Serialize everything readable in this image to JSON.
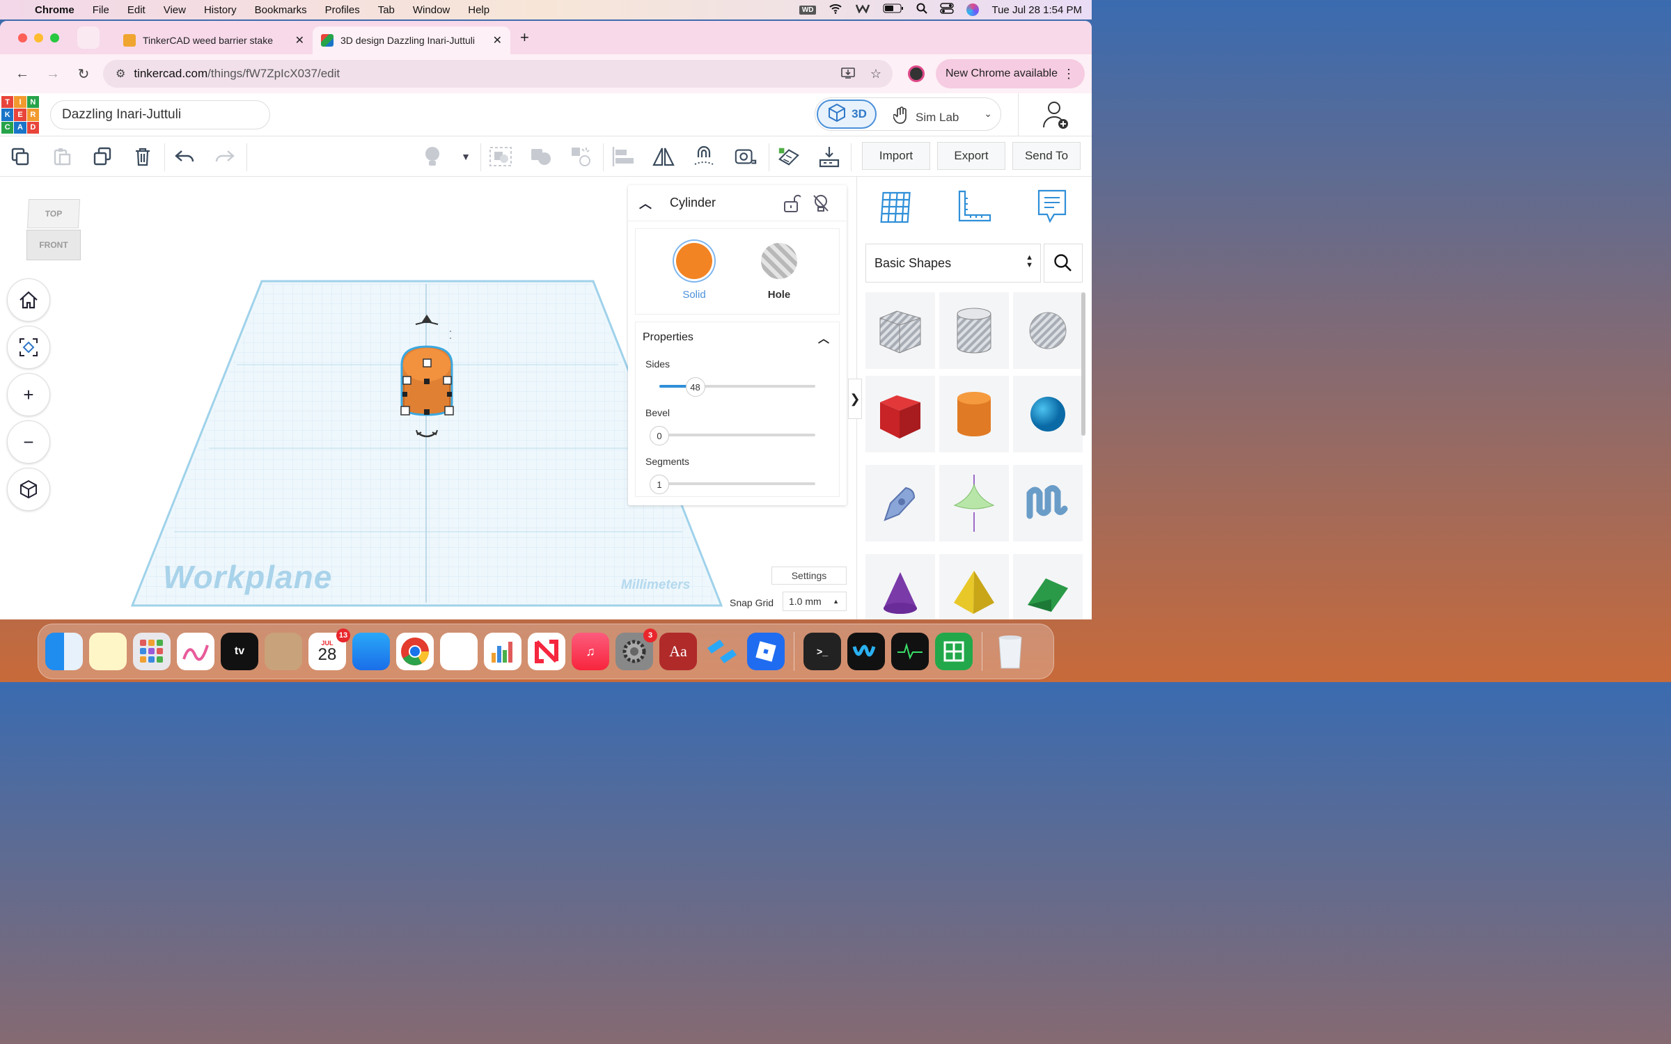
{
  "menubar": {
    "app": "Chrome",
    "items": [
      "File",
      "Edit",
      "View",
      "History",
      "Bookmarks",
      "Profiles",
      "Tab",
      "Window",
      "Help"
    ],
    "wd": "WD",
    "datetime": "Tue Jul 28  1:54 PM"
  },
  "browser": {
    "tabs": [
      {
        "title": "TinkerCAD weed barrier stake"
      },
      {
        "title": "3D design Dazzling Inari-Juttuli"
      }
    ],
    "url_domain": "tinkercad.com",
    "url_path": "/things/fW7ZpIcX037/edit",
    "new_chrome": "New Chrome available"
  },
  "logo": [
    "T",
    "I",
    "N",
    "K",
    "E",
    "R",
    "C",
    "A",
    "D"
  ],
  "header": {
    "design_name": "Dazzling Inari-Juttuli",
    "mode_3d": "3D",
    "mode_sim": "Sim Lab"
  },
  "toolbar": {
    "import": "Import",
    "export": "Export",
    "send_to": "Send To"
  },
  "viewcube": {
    "top": "TOP",
    "front": "FRONT"
  },
  "inspector": {
    "shape_name": "Cylinder",
    "solid_label": "Solid",
    "hole_label": "Hole",
    "properties_label": "Properties",
    "props": [
      {
        "label": "Sides",
        "value": "48",
        "fraction": 0.23
      },
      {
        "label": "Bevel",
        "value": "0",
        "fraction": 0
      },
      {
        "label": "Segments",
        "value": "1",
        "fraction": 0
      }
    ]
  },
  "workplane": {
    "label": "Workplane",
    "units": "Millimeters",
    "settings": "Settings",
    "snap_label": "Snap Grid",
    "snap_value": "1.0 mm"
  },
  "library": {
    "selected": "Basic Shapes",
    "shapes": [
      "box-hole",
      "cylinder-hole",
      "sphere-hole",
      "box",
      "cylinder",
      "sphere",
      "scribble",
      "paraboloid",
      "text-squiggle",
      "cone",
      "pyramid",
      "roof"
    ]
  },
  "dock": {
    "calendar_month": "JUL",
    "calendar_day": "28",
    "calendar_badge": "13",
    "settings_badge": "3"
  },
  "colors": {
    "accent": "#2f8fd8",
    "solid": "#f28424",
    "tab_bg": "#f7d9ea"
  }
}
